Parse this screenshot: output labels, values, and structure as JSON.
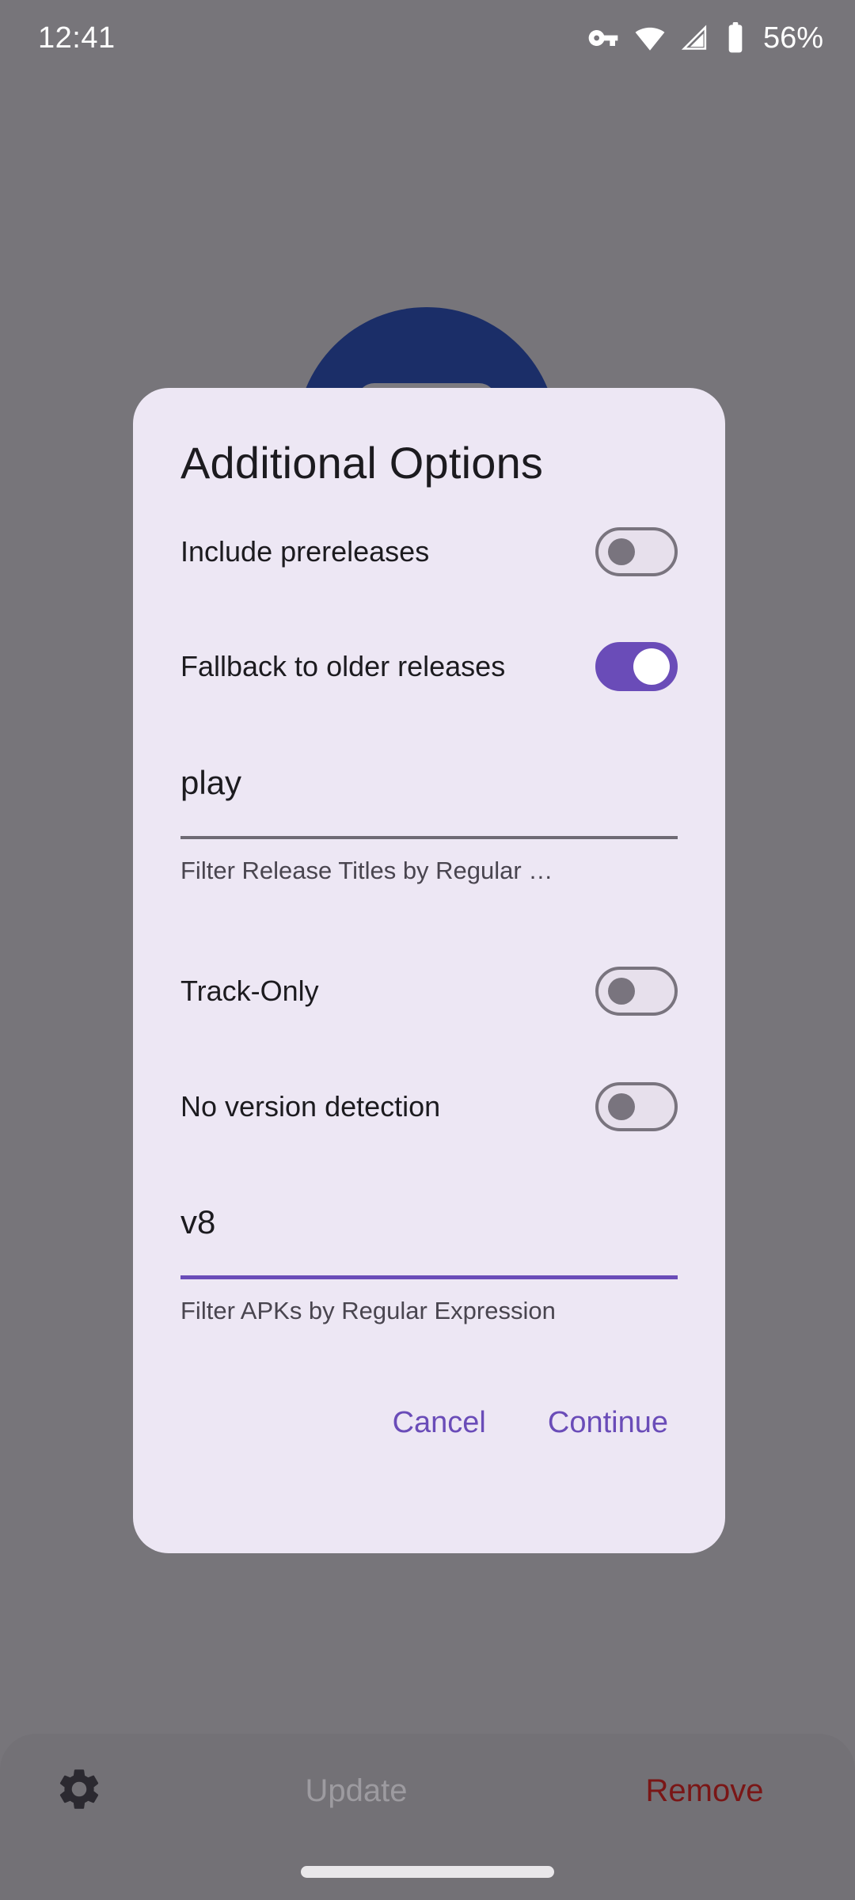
{
  "status_bar": {
    "clock": "12:41",
    "battery_percent": "56%",
    "icons": [
      "vpn-key-icon",
      "wifi-icon",
      "cellular-signal-icon",
      "battery-icon"
    ]
  },
  "background": {
    "app_icon_color": "#1B2E68",
    "scrim_color": "#77757A"
  },
  "dialog": {
    "title": "Additional Options",
    "background_color": "#EDE7F4",
    "accent_color": "#6A4CB8",
    "switches": [
      {
        "label": "Include prereleases",
        "state": "off"
      },
      {
        "label": "Fallback to older releases",
        "state": "on"
      },
      {
        "label": "Track-Only",
        "state": "off"
      },
      {
        "label": "No version detection",
        "state": "off"
      }
    ],
    "fields": [
      {
        "value": "play",
        "helper": "Filter Release Titles by Regular …",
        "focused": false
      },
      {
        "value": "v8",
        "helper": "Filter APKs by Regular Expression",
        "focused": true
      }
    ],
    "actions": {
      "cancel_label": "Cancel",
      "continue_label": "Continue"
    }
  },
  "bottom_bar": {
    "settings_icon": "gear-icon",
    "update_label": "Update",
    "remove_label": "Remove",
    "remove_color": "#7A1616",
    "update_color": "#9D9BA0"
  }
}
